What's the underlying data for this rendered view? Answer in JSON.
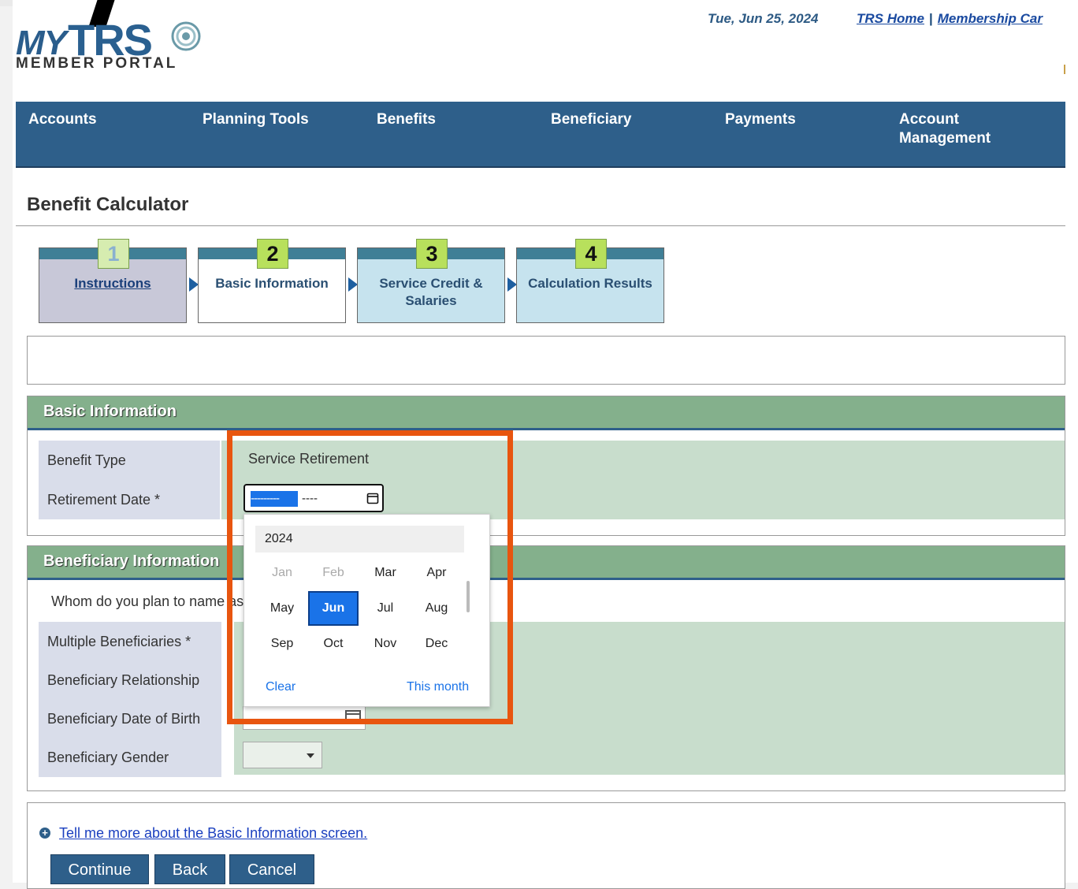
{
  "header": {
    "logo_my": "MY",
    "logo_trs": "TRS",
    "logo_sub": "MEMBER PORTAL",
    "date": "Tue, Jun 25, 2024",
    "links": [
      "TRS Home",
      "Membership Car"
    ],
    "link_separator": "|"
  },
  "nav": {
    "items": [
      "Accounts",
      "Planning Tools",
      "Benefits",
      "Beneficiary",
      "Payments",
      "Account Management"
    ]
  },
  "page_title": "Benefit Calculator",
  "steps": [
    {
      "num": "1",
      "label": "Instructions"
    },
    {
      "num": "2",
      "label": "Basic Information"
    },
    {
      "num": "3",
      "label": "Service Credit & Salaries"
    },
    {
      "num": "4",
      "label": "Calculation Results"
    }
  ],
  "basic_info": {
    "title": "Basic Information",
    "benefit_type_label": "Benefit Type",
    "benefit_type_value": "Service Retirement",
    "retirement_date_label": "Retirement Date *",
    "retirement_date_month_placeholder": "---------",
    "retirement_date_year_placeholder": "----"
  },
  "beneficiary_info": {
    "title": "Beneficiary Information",
    "question": "Whom do you plan to name as",
    "multiple_label": "Multiple Beneficiaries *",
    "relationship_label": "Beneficiary Relationship",
    "dob_label": "Beneficiary Date of Birth",
    "gender_label": "Beneficiary Gender"
  },
  "month_picker": {
    "year": "2024",
    "months": [
      "Jan",
      "Feb",
      "Mar",
      "Apr",
      "May",
      "Jun",
      "Jul",
      "Aug",
      "Sep",
      "Oct",
      "Nov",
      "Dec"
    ],
    "disabled": [
      "Jan",
      "Feb"
    ],
    "selected": "Jun",
    "clear_label": "Clear",
    "this_month_label": "This month"
  },
  "footer": {
    "help_icon": "+",
    "help_link": "Tell me more about the Basic Information screen.",
    "buttons": [
      "Continue",
      "Back",
      "Cancel"
    ]
  },
  "colors": {
    "nav_blue": "#2e5f8a",
    "section_green": "#84b08c",
    "value_green": "#c8ddcc",
    "label_lavender": "#d9ddea",
    "step_number": "#b8e05c",
    "picker_selected": "#1a73e8",
    "highlight_orange": "#e8550f"
  }
}
